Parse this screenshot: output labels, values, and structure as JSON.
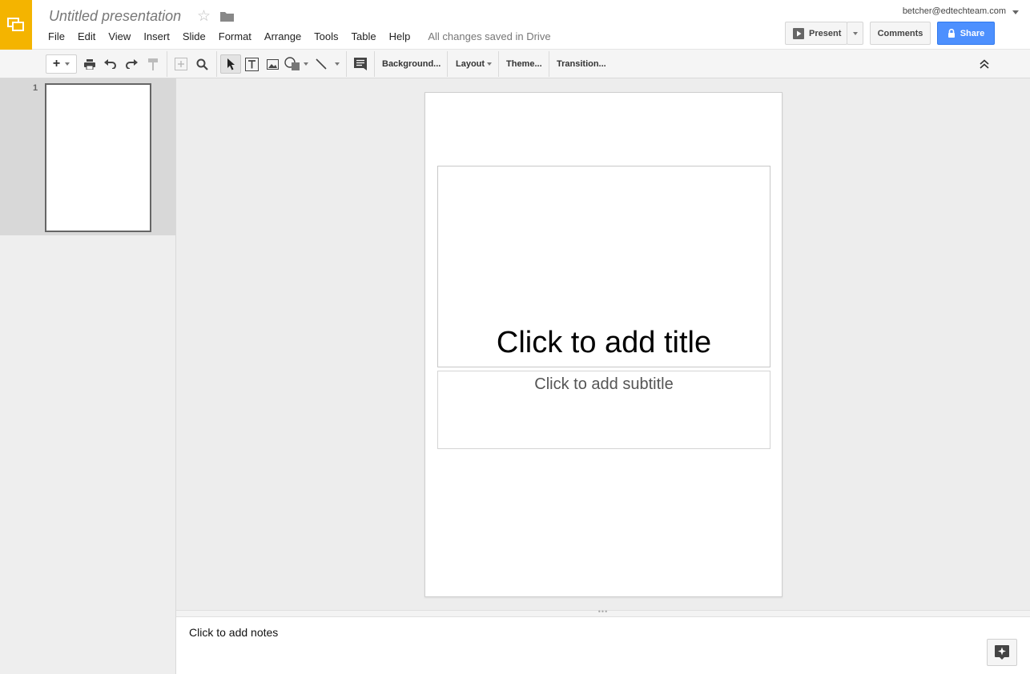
{
  "header": {
    "title": "Untitled presentation",
    "account": "betcher@edtechteam.com",
    "present_label": "Present",
    "comments_label": "Comments",
    "share_label": "Share",
    "brand_color": "#f4b400",
    "share_color": "#4d90fe"
  },
  "menu": {
    "items": [
      "File",
      "Edit",
      "View",
      "Insert",
      "Slide",
      "Format",
      "Arrange",
      "Tools",
      "Table",
      "Help"
    ],
    "save_status": "All changes saved in Drive"
  },
  "toolbar": {
    "icons": [
      "new-slide-icon",
      "print-icon",
      "undo-icon",
      "redo-icon",
      "paint-format-icon",
      "fit-icon",
      "zoom-icon",
      "select-icon",
      "text-box-icon",
      "image-icon",
      "shape-icon",
      "line-icon",
      "comment-icon",
      "collapse-icon"
    ],
    "background_label": "Background...",
    "layout_label": "Layout",
    "theme_label": "Theme...",
    "transition_label": "Transition..."
  },
  "filmstrip": {
    "slides": [
      {
        "number": "1"
      }
    ]
  },
  "slide": {
    "title_placeholder": "Click to add title",
    "subtitle_placeholder": "Click to add subtitle"
  },
  "notes": {
    "placeholder": "Click to add notes"
  }
}
